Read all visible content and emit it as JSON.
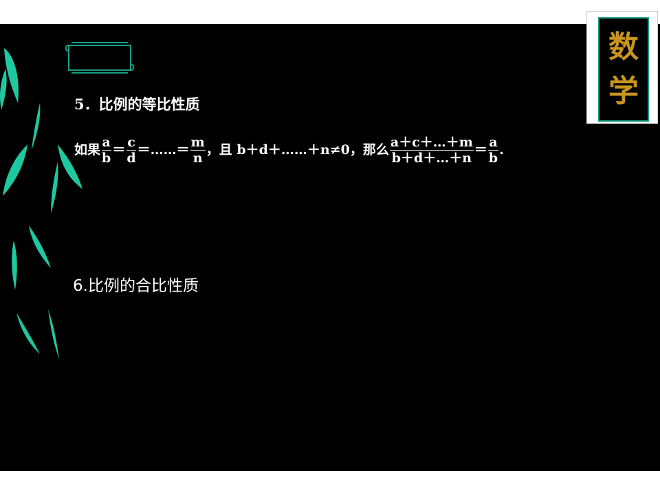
{
  "badge": {
    "line1": "数",
    "line2": "学"
  },
  "section5": {
    "heading": "5．比例的等比性质",
    "formula": {
      "lead": "如果",
      "f1_num": "a",
      "f1_den": "b",
      "eq1": "＝",
      "f2_num": "c",
      "f2_den": "d",
      "eq2": "＝……＝",
      "f3_num": "m",
      "f3_den": "n",
      "condition": "，且 b＋d＋……＋n≠0，那么",
      "f4_num": "a＋c＋…＋m",
      "f4_den": "b＋d＋…＋n",
      "eq3": "＝",
      "f5_num": "a",
      "f5_den": "b",
      "end": "."
    }
  },
  "section6": {
    "heading": "6.比例的合比性质"
  },
  "colors": {
    "background": "#000000",
    "leaf": "#1ec8a0",
    "badge_text": "#c8961e",
    "badge_border": "#1a9f86"
  }
}
